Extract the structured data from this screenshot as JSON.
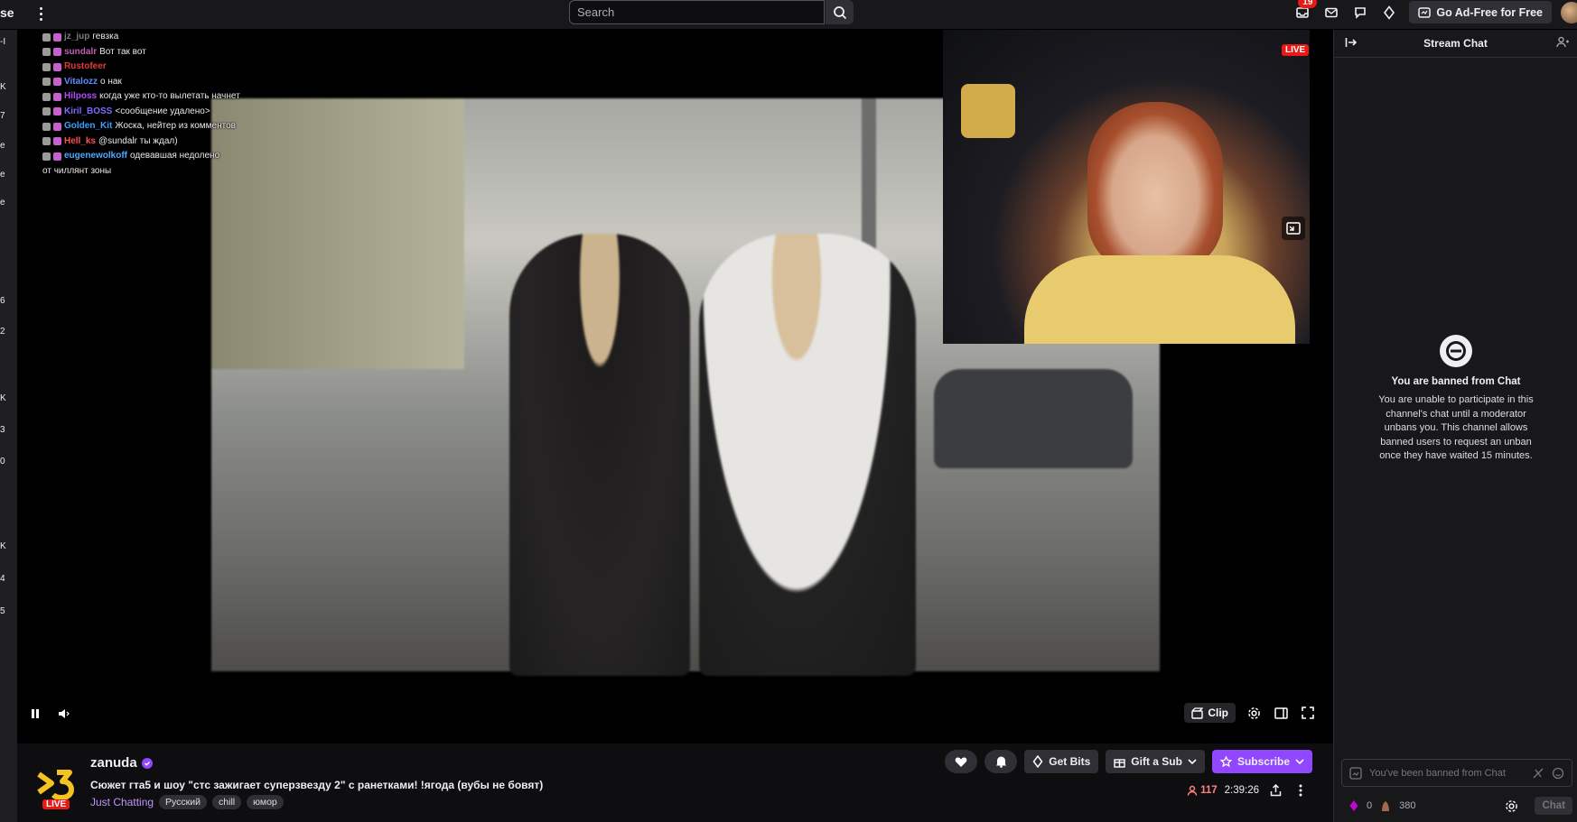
{
  "topbar": {
    "logo_fragment": "se",
    "search_placeholder": "Search",
    "notifications_count": "19",
    "adfree_label": "Go Ad-Free for Free"
  },
  "left_strip": [
    "-I",
    "K",
    "7",
    "e",
    "e",
    "e",
    "6",
    "2",
    "K",
    "3",
    "0",
    "K",
    "4",
    "5"
  ],
  "player": {
    "live_badge": "LIVE",
    "clip_label": "Clip",
    "overlay_chat": [
      {
        "user": "jz_jup",
        "text": "гевзка",
        "color": "#7a7a7a"
      },
      {
        "user": "sundalr",
        "text": "Вот так вот",
        "color": "#c05fb0"
      },
      {
        "user": "Rustofeer",
        "text": "",
        "color": "#e03a3a"
      },
      {
        "user": "Vitalozz",
        "text": "о нак",
        "color": "#5f8bff"
      },
      {
        "user": "Hilposs",
        "text": "когда уже кто-то вылетать начнет",
        "color": "#b04aff"
      },
      {
        "user": "Kiril_BOSS",
        "text": "<сообщение удалено>",
        "color": "#7a6cff"
      },
      {
        "user": "Golden_Kit",
        "text": "Жоска, нейтер из комментов",
        "color": "#3aa0ff"
      },
      {
        "user": "Hell_ks",
        "text": "@sundalr ты ждал)",
        "color": "#ff4f4f"
      },
      {
        "user": "eugenewolkoff",
        "text": "одевавшая недолено",
        "color": "#4aa8ff"
      },
      {
        "user": "",
        "text": "от чиллянт зоны",
        "color": "#e9e9e9"
      }
    ]
  },
  "channel": {
    "name": "zanuda",
    "live_label": "LIVE",
    "title": "Сюжет гта5 и шоу \"стс зажигает суперзвезду 2\" с ранетками! !ягода (вубы не бовят)",
    "category": "Just Chatting",
    "tags": [
      "Русский",
      "chill",
      "юмор"
    ],
    "viewers": "117",
    "uptime": "2:39:26",
    "get_bits_label": "Get Bits",
    "gift_sub_label": "Gift a Sub",
    "subscribe_label": "Subscribe"
  },
  "chat": {
    "header": "Stream Chat",
    "ban_title": "You are banned from Chat",
    "ban_text": "You are unable to participate in this channel's chat until a moderator unbans you. This channel allows banned users to request an unban once they have waited 15 minutes.",
    "input_placeholder": "You've been banned from Chat",
    "bits_count": "0",
    "points_count": "380",
    "send_label": "Chat"
  },
  "colors": {
    "accent": "#9147ff",
    "live": "#e91916",
    "viewers": "#ff8280",
    "category": "#bf94ff"
  }
}
